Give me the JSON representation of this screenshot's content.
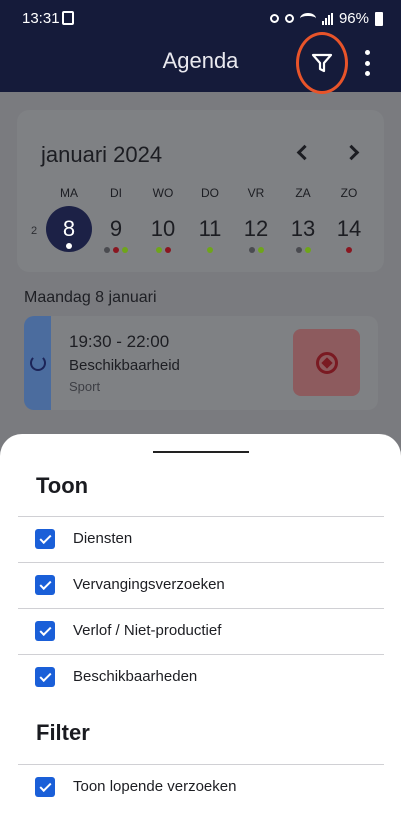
{
  "status_bar": {
    "time": "13:31",
    "battery": "96%"
  },
  "app_bar": {
    "title": "Agenda"
  },
  "calendar": {
    "month_label": "januari 2024",
    "week_number": "2",
    "days": [
      {
        "name": "MA",
        "number": "8",
        "selected": true,
        "dots": [
          "#ffffff"
        ]
      },
      {
        "name": "DI",
        "number": "9",
        "selected": false,
        "dots": [
          "#4a4b50",
          "#8a1620",
          "#6fa51a"
        ]
      },
      {
        "name": "WO",
        "number": "10",
        "selected": false,
        "dots": [
          "#6fa51a",
          "#8a1620"
        ]
      },
      {
        "name": "DO",
        "number": "11",
        "selected": false,
        "dots": [
          "#6fa51a"
        ]
      },
      {
        "name": "VR",
        "number": "12",
        "selected": false,
        "dots": [
          "#4a4b50",
          "#6fa51a"
        ]
      },
      {
        "name": "ZA",
        "number": "13",
        "selected": false,
        "dots": [
          "#4a4b50",
          "#6fa51a"
        ]
      },
      {
        "name": "ZO",
        "number": "14",
        "selected": false,
        "dots": [
          "#8a1620"
        ]
      }
    ]
  },
  "agenda": {
    "date_heading": "Maandag 8 januari",
    "event": {
      "time": "19:30 - 22:00",
      "title": "Beschikbaarheid",
      "subtitle": "Sport",
      "icon": "soccer-ball-icon"
    }
  },
  "sheet": {
    "show_heading": "Toon",
    "show_options": [
      {
        "label": "Diensten",
        "checked": true
      },
      {
        "label": "Vervangingsverzoeken",
        "checked": true
      },
      {
        "label": "Verlof / Niet-productief",
        "checked": true
      },
      {
        "label": "Beschikbaarheden",
        "checked": true
      }
    ],
    "filter_heading": "Filter",
    "filter_options": [
      {
        "label": "Toon lopende verzoeken",
        "checked": true
      }
    ]
  },
  "colors": {
    "app_bar": "#151b3a",
    "accent_checkbox": "#1a5fd8",
    "highlight_ring": "#e8542a"
  }
}
